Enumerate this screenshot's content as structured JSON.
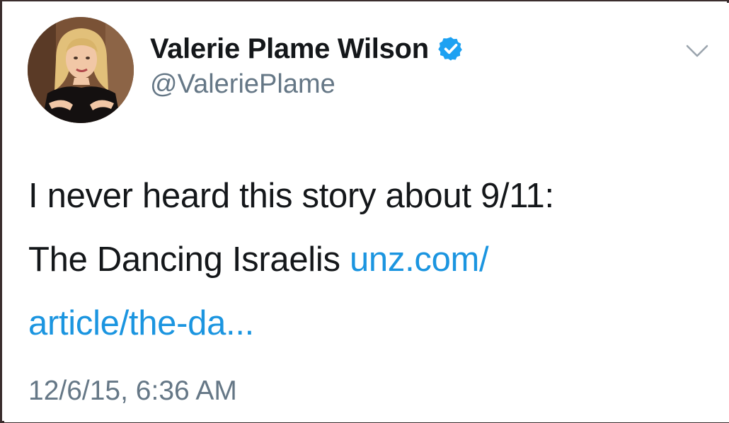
{
  "tweet": {
    "display_name": "Valerie Plame Wilson",
    "handle": "@ValeriePlame",
    "text_line1": "I never heard this story about 9/11:",
    "text_line2_plain": "The Dancing Israelis ",
    "link_part1": "unz.com/",
    "link_part2": "article/the-da...",
    "timestamp": "12/6/15, 6:36 AM"
  },
  "icons": {
    "verified": "verified-badge-icon",
    "menu": "chevron-down-icon",
    "avatar": "profile-photo"
  },
  "colors": {
    "link": "#1b95e0",
    "verified": "#1da1f2",
    "secondary_text": "#657786",
    "primary_text": "#14171a"
  }
}
